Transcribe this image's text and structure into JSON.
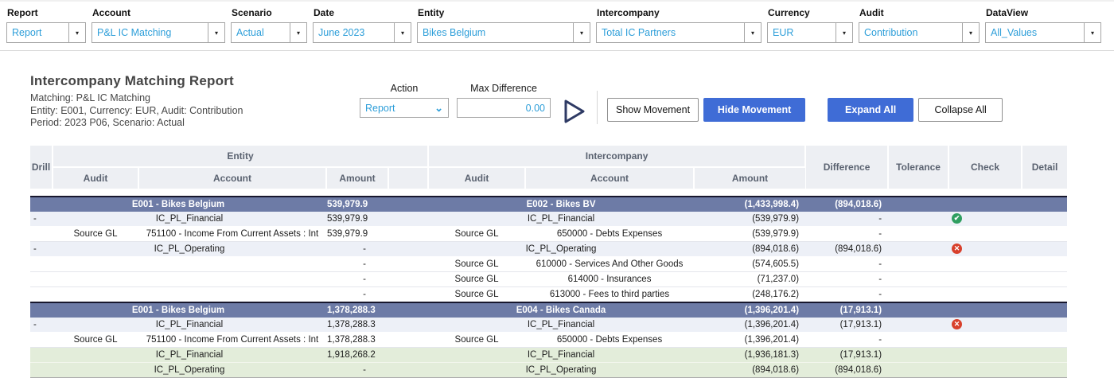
{
  "filters": [
    {
      "label": "Report",
      "value": "Report"
    },
    {
      "label": "Account",
      "value": "P&L IC Matching"
    },
    {
      "label": "Scenario",
      "value": "Actual"
    },
    {
      "label": "Date",
      "value": "June 2023"
    },
    {
      "label": "Entity",
      "value": "Bikes Belgium"
    },
    {
      "label": "Intercompany",
      "value": "Total IC Partners"
    },
    {
      "label": "Currency",
      "value": "EUR"
    },
    {
      "label": "Audit",
      "value": "Contribution"
    },
    {
      "label": "DataView",
      "value": "All_Values"
    }
  ],
  "report": {
    "title": "Intercompany Matching Report",
    "subtitle_lines": [
      "Matching: P&L IC Matching",
      "Entity: E001, Currency: EUR, Audit: Contribution",
      "Period: 2023 P06, Scenario: Actual"
    ]
  },
  "controls": {
    "action_label": "Action",
    "action_value": "Report",
    "max_difference_label": "Max Difference",
    "max_difference_value": "0.00",
    "buttons": [
      {
        "label": "Show Movement",
        "style": "secondary"
      },
      {
        "label": "Hide Movement",
        "style": "primary"
      },
      {
        "label": "Expand All",
        "style": "primary"
      },
      {
        "label": "Collapse All",
        "style": "secondary"
      }
    ]
  },
  "table": {
    "header": {
      "drill": "Drill",
      "entity_group": "Entity",
      "intercompany_group": "Intercompany",
      "audit": "Audit",
      "account": "Account",
      "amount": "Amount",
      "difference": "Difference",
      "tolerance": "Tolerance",
      "check": "Check",
      "detail": "Detail"
    },
    "rows": [
      {
        "type": "group",
        "drill": "",
        "e_audit": "",
        "e_account": "E001 - Bikes Belgium",
        "e_amount": "539,979.9",
        "i_audit": "",
        "i_account": "E002 - Bikes BV",
        "i_amount": "(1,433,998.4)",
        "difference": "(894,018.6)",
        "tolerance": "",
        "check": "",
        "detail": ""
      },
      {
        "type": "detail",
        "drill": "-",
        "e_audit": "",
        "e_account": "IC_PL_Financial",
        "e_amount": "539,979.9",
        "i_audit": "",
        "i_account": "IC_PL_Financial",
        "i_amount": "(539,979.9)",
        "difference": "-",
        "tolerance": "",
        "check": "ok",
        "detail": ""
      },
      {
        "type": "source",
        "drill": "",
        "e_audit": "Source GL",
        "e_account": "751100 - Income From Current Assets : Int",
        "e_amount": "539,979.9",
        "i_audit": "Source GL",
        "i_account": "650000 - Debts Expenses",
        "i_amount": "(539,979.9)",
        "difference": "-",
        "tolerance": "",
        "check": "",
        "detail": ""
      },
      {
        "type": "detail",
        "drill": "-",
        "e_audit": "",
        "e_account": "IC_PL_Operating",
        "e_amount": "-",
        "i_audit": "",
        "i_account": "IC_PL_Operating",
        "i_amount": "(894,018.6)",
        "difference": "(894,018.6)",
        "tolerance": "",
        "check": "error",
        "detail": ""
      },
      {
        "type": "source",
        "drill": "",
        "e_audit": "",
        "e_account": "",
        "e_amount": "-",
        "i_audit": "Source GL",
        "i_account": "610000 - Services And Other Goods",
        "i_amount": "(574,605.5)",
        "difference": "-",
        "tolerance": "",
        "check": "",
        "detail": ""
      },
      {
        "type": "source",
        "drill": "",
        "e_audit": "",
        "e_account": "",
        "e_amount": "-",
        "i_audit": "Source GL",
        "i_account": "614000 - Insurances",
        "i_amount": "(71,237.0)",
        "difference": "-",
        "tolerance": "",
        "check": "",
        "detail": ""
      },
      {
        "type": "source",
        "drill": "",
        "e_audit": "",
        "e_account": "",
        "e_amount": "-",
        "i_audit": "Source GL",
        "i_account": "613000 - Fees to third parties",
        "i_amount": "(248,176.2)",
        "difference": "-",
        "tolerance": "",
        "check": "",
        "detail": ""
      },
      {
        "type": "group",
        "drill": "",
        "e_audit": "",
        "e_account": "E001 - Bikes Belgium",
        "e_amount": "1,378,288.3",
        "i_audit": "",
        "i_account": "E004 - Bikes Canada",
        "i_amount": "(1,396,201.4)",
        "difference": "(17,913.1)",
        "tolerance": "",
        "check": "",
        "detail": ""
      },
      {
        "type": "detail",
        "drill": "-",
        "e_audit": "",
        "e_account": "IC_PL_Financial",
        "e_amount": "1,378,288.3",
        "i_audit": "",
        "i_account": "IC_PL_Financial",
        "i_amount": "(1,396,201.4)",
        "difference": "(17,913.1)",
        "tolerance": "",
        "check": "error",
        "detail": ""
      },
      {
        "type": "source",
        "drill": "",
        "e_audit": "Source GL",
        "e_account": "751100 - Income From Current Assets : Int",
        "e_amount": "1,378,288.3",
        "i_audit": "Source GL",
        "i_account": "650000 - Debts Expenses",
        "i_amount": "(1,396,201.4)",
        "difference": "-",
        "tolerance": "",
        "check": "",
        "detail": ""
      },
      {
        "type": "summary",
        "drill": "",
        "e_audit": "",
        "e_account": "IC_PL_Financial",
        "e_amount": "1,918,268.2",
        "i_audit": "",
        "i_account": "IC_PL_Financial",
        "i_amount": "(1,936,181.3)",
        "difference": "(17,913.1)",
        "tolerance": "",
        "check": "",
        "detail": ""
      },
      {
        "type": "summary",
        "drill": "",
        "e_audit": "",
        "e_account": "IC_PL_Operating",
        "e_amount": "-",
        "i_audit": "",
        "i_account": "IC_PL_Operating",
        "i_amount": "(894,018.6)",
        "difference": "(894,018.6)",
        "tolerance": "",
        "check": "",
        "detail": ""
      }
    ]
  },
  "colors": {
    "dropdown_text": "#2d9ed9",
    "primary_button": "#3f6cd6",
    "group_row": "#6d7ba6",
    "detail_row": "#edf0f7",
    "summary_row": "#e3edda",
    "check_ok": "#2f9e60",
    "check_error": "#d8402c"
  }
}
